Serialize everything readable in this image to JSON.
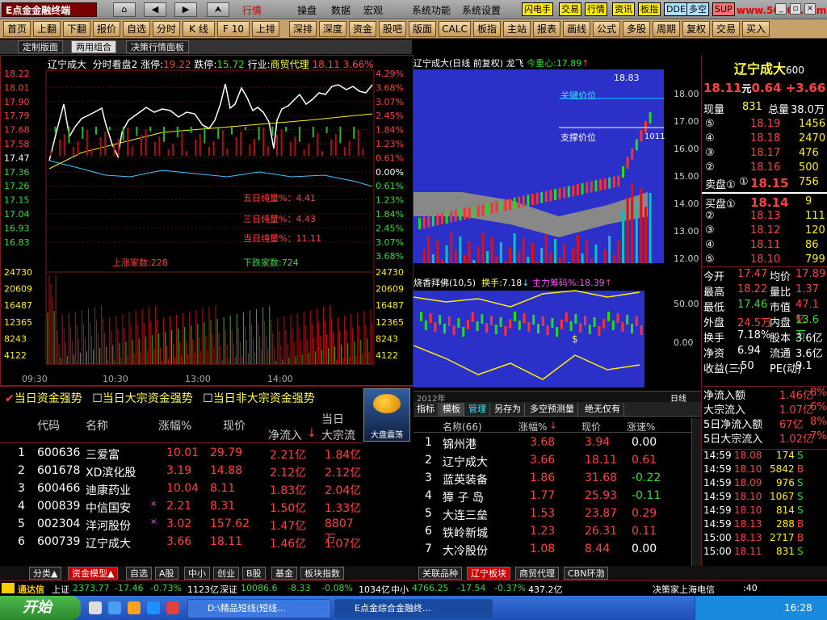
{
  "app": {
    "title": "E点金金融终端"
  },
  "menu": [
    "行情",
    "操盘",
    "数据",
    "宏观",
    "系统功能",
    "系统设置"
  ],
  "quick_btns": [
    "闪电手",
    "交易",
    "行情",
    "资讯",
    "板指",
    "DDE",
    "多空",
    "SUP"
  ],
  "watermark": "www.50168.com",
  "toolbar": [
    "首页",
    "上翻",
    "下翻",
    "报价",
    "自选",
    "分时",
    "K 线",
    "F 10",
    "上排",
    "深排",
    "深度",
    "资金",
    "股吧",
    "版面",
    "CALC",
    "板指",
    "主站",
    "报表",
    "画线",
    "公式",
    "多股",
    "周期",
    "复权",
    "交易",
    "买入"
  ],
  "tabs": [
    "定制版面",
    "两用组合",
    "决策行情面板"
  ],
  "intraday": {
    "title": "辽宁成大",
    "sub": "分时看盘2",
    "zt_label": "涨停:",
    "zt": "19.22",
    "dt_label": "跌停:",
    "dt": "15.72",
    "ind_label": "行业:",
    "ind": "商贸代理",
    "price": "18.11",
    "pct": "3.66%",
    "left_ticks": [
      "18.22",
      "18.01",
      "17.90",
      "17.79",
      "17.68",
      "17.58",
      "17.47",
      "17.36",
      "17.26",
      "17.15",
      "17.04",
      "16.93",
      "16.83"
    ],
    "right_ticks": [
      "4.29%",
      "3.68%",
      "3.07%",
      "2.45%",
      "1.84%",
      "1.23%",
      "0.61%",
      "0.00%",
      "0.61%",
      "1.23%",
      "1.84%",
      "2.45%",
      "3.07%",
      "3.68%"
    ],
    "five_day": "五日纯量%：4.41",
    "three_day": "三日纯量%：4.43",
    "today": "当日纯量%：11.11",
    "up_count": "上涨家数:228",
    "down_count": "下跌家数:724",
    "vol_ticks": [
      "24730",
      "20609",
      "16487",
      "12365",
      "8243",
      "4122"
    ],
    "times": [
      "09:30",
      "10:30",
      "13:00",
      "14:00"
    ]
  },
  "kline": {
    "title": "辽宁成大(日线 前复权) 龙飞",
    "focus_label": "今重心:",
    "focus": "17.89",
    "high_label": "18.83",
    "key_price": "关键价位",
    "support": "支撑价位",
    "val101": "1011",
    "val1011": "1011",
    "ticks": [
      "18.00",
      "17.00",
      "16.00",
      "15.00",
      "14.00",
      "13.00",
      "12.00"
    ],
    "ind_title": "烧香拜佛(10,5)",
    "hs_label": "换手:",
    "hs": "7.18",
    "zl_label": "主力筹码%:",
    "zl": "18.39",
    "ind_ticks": [
      "50.00",
      "0.00"
    ],
    "year": "2012年",
    "period": "日线"
  },
  "quote": {
    "name": "辽宁成大",
    "code": "600",
    "price": "18.11",
    "unit": "元",
    "chg": "0.64",
    "pct": "+3.66",
    "xianliang_label": "现量",
    "xianliang": "831",
    "zongliang_label": "总量",
    "zongliang": "38.0万",
    "sells": [
      {
        "lv": "⑤",
        "p": "18.19",
        "v": "1456"
      },
      {
        "lv": "④",
        "p": "18.18",
        "v": "2470"
      },
      {
        "lv": "③",
        "p": "18.17",
        "v": "476"
      },
      {
        "lv": "②",
        "p": "18.16",
        "v": "500"
      },
      {
        "lv": "①",
        "p": "18.15",
        "v": "756"
      }
    ],
    "sell1_label": "卖盘①",
    "buy1_label": "买盘①",
    "buys": [
      {
        "lv": "①",
        "p": "18.14",
        "v": "9"
      },
      {
        "lv": "②",
        "p": "18.13",
        "v": "111"
      },
      {
        "lv": "③",
        "p": "18.12",
        "v": "120"
      },
      {
        "lv": "④",
        "p": "18.11",
        "v": "86"
      },
      {
        "lv": "⑤",
        "p": "18.10",
        "v": "799"
      }
    ],
    "stats": [
      [
        "今开",
        "17.47",
        "均价",
        "17.89"
      ],
      [
        "最高",
        "18.22",
        "量比",
        "1.37"
      ],
      [
        "最低",
        "17.46",
        "市值",
        "47.1亿"
      ],
      [
        "外盘",
        "24.5万",
        "内盘",
        "13.6万"
      ],
      [
        "换手",
        "7.18%",
        "股本",
        "3.6亿"
      ],
      [
        "净资",
        "6.94",
        "流通",
        "3.6亿"
      ],
      [
        "收益(三)",
        ".50",
        "PE(动)",
        "9.1"
      ]
    ],
    "flows": [
      [
        "净流入额",
        "1.46亿",
        "8%"
      ],
      [
        "大宗流入",
        "1.07亿",
        "6%"
      ],
      [
        "5日净流入额",
        "67亿",
        "8%"
      ],
      [
        "5日大宗流入",
        "1.02亿",
        "7%"
      ]
    ],
    "ticks": [
      [
        "14:59",
        "18.08",
        "174",
        "S"
      ],
      [
        "14:59",
        "18.10",
        "5842",
        "B"
      ],
      [
        "14:59",
        "18.09",
        "976",
        "S"
      ],
      [
        "14:59",
        "18.10",
        "1067",
        "S"
      ],
      [
        "14:59",
        "18.10",
        "814",
        "S"
      ],
      [
        "14:59",
        "18.13",
        "288",
        "B"
      ],
      [
        "15:00",
        "18.13",
        "2717",
        "B"
      ],
      [
        "15:00",
        "18.11",
        "831",
        "S"
      ]
    ]
  },
  "fund": {
    "checks": [
      "当日资金强势",
      "当日大宗资金强势",
      "当日非大宗资金强势"
    ],
    "weather": "大盘震荡",
    "headers": [
      "代码",
      "名称",
      "涨幅%",
      "现价",
      "净流入",
      "大宗流",
      "当日"
    ],
    "rows": [
      [
        "1",
        "600636",
        "三爱富",
        "10.01",
        "29.79",
        "2.21亿",
        "1.84亿"
      ],
      [
        "2",
        "601678",
        "XD滨化股",
        "3.19",
        "14.88",
        "2.12亿",
        "2.12亿"
      ],
      [
        "3",
        "600466",
        "迪康药业",
        "10.04",
        "8.11",
        "1.83亿",
        "2.04亿"
      ],
      [
        "4",
        "000839",
        "中信国安",
        "2.21",
        "8.31",
        "1.50亿",
        "1.33亿"
      ],
      [
        "5",
        "002304",
        "洋河股份",
        "3.02",
        "157.62",
        "1.47亿",
        "8807万"
      ],
      [
        "6",
        "600739",
        "辽宁成大",
        "3.66",
        "18.11",
        "1.46亿",
        "1.07亿"
      ]
    ]
  },
  "sector": {
    "tabs": [
      "指标",
      "模板",
      "管理",
      "另存为",
      "多空预测量",
      "绝无仅有"
    ],
    "headers": [
      "名称(66)",
      "涨幅%",
      "现价",
      "涨速%"
    ],
    "rows": [
      [
        "1",
        "锦州港",
        "3.68",
        "3.94",
        "0.00"
      ],
      [
        "2",
        "辽宁成大",
        "3.66",
        "18.11",
        "0.61"
      ],
      [
        "3",
        "蓝英装备",
        "1.86",
        "31.68",
        "-0.22"
      ],
      [
        "4",
        "獐 子 岛",
        "1.77",
        "25.93",
        "-0.11"
      ],
      [
        "5",
        "大连三垒",
        "1.53",
        "23.87",
        "0.29"
      ],
      [
        "6",
        "铁岭新城",
        "1.23",
        "26.31",
        "0.11"
      ],
      [
        "7",
        "大冷股份",
        "1.08",
        "8.44",
        "0.00"
      ]
    ]
  },
  "bottom_tabs_left": [
    "分类▲",
    "资金模型▲",
    "自选",
    "A股",
    "中小",
    "创业",
    "B股",
    "基金",
    "板块指数"
  ],
  "bottom_tabs_right": [
    "关联品种",
    "辽宁板块",
    "商贸代理",
    "CBN环渤"
  ],
  "status": {
    "src": "通达信",
    "sh_label": "上证",
    "sh": "2373.77",
    "sh_chg": "-17.46",
    "sh_pct": "-0.73%",
    "sh_amt": "1123亿",
    "sz_label": "深证",
    "sz": "10086.6",
    "sz_chg": "-8.33",
    "sz_pct": "-0.08%",
    "sz_amt": "1034亿",
    "zx_label": "中小",
    "zx": "4766.25",
    "zx_chg": "-17.54",
    "zx_pct": "-0.37%",
    "zx_amt": "437.2亿",
    "right": "决策家上海电信",
    "right2": ":40"
  },
  "taskbar": {
    "start": "开始",
    "tasks": [
      "D:\\精品短线(短线...",
      "E点金综合金融终..."
    ],
    "clock": "16:28"
  }
}
